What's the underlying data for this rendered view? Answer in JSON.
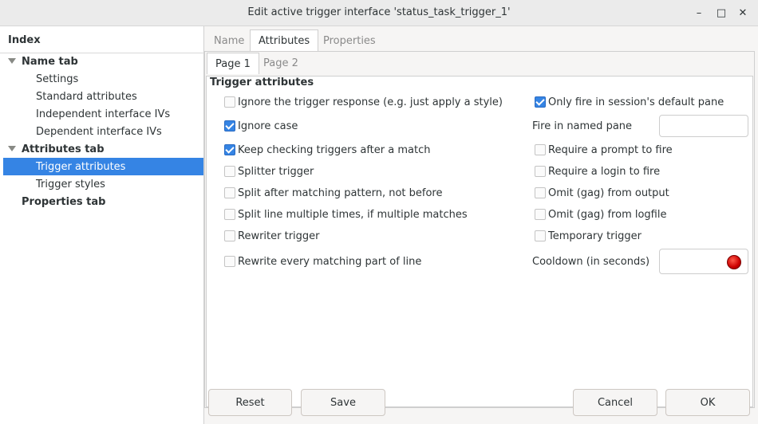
{
  "window": {
    "title": "Edit active trigger interface 'status_task_trigger_1'",
    "minimize_glyph": "–",
    "maximize_glyph": "□",
    "close_glyph": "✕"
  },
  "sidebar": {
    "header": "Index",
    "items": [
      {
        "label": "Name tab",
        "level": 0,
        "expanded": true
      },
      {
        "label": "Settings",
        "level": 1
      },
      {
        "label": "Standard attributes",
        "level": 1
      },
      {
        "label": "Independent interface IVs",
        "level": 1
      },
      {
        "label": "Dependent interface IVs",
        "level": 1
      },
      {
        "label": "Attributes tab",
        "level": 0,
        "expanded": true
      },
      {
        "label": "Trigger attributes",
        "level": 1,
        "selected": true
      },
      {
        "label": "Trigger styles",
        "level": 1
      },
      {
        "label": "Properties tab",
        "level": 0
      }
    ]
  },
  "tabs": [
    {
      "label": "Name",
      "active": false
    },
    {
      "label": "Attributes",
      "active": true
    },
    {
      "label": "Properties",
      "active": false
    }
  ],
  "subtabs": [
    {
      "label": "Page 1",
      "active": true
    },
    {
      "label": "Page 2",
      "active": false
    }
  ],
  "section": {
    "title": "Trigger attributes"
  },
  "left_options": [
    {
      "label": "Ignore the trigger response (e.g. just apply a style)",
      "checked": false
    },
    {
      "label": "Ignore case",
      "checked": true
    },
    {
      "label": "Keep checking triggers after a match",
      "checked": true
    },
    {
      "label": "Splitter trigger",
      "checked": false
    },
    {
      "label": "Split after matching pattern, not before",
      "checked": false
    },
    {
      "label": "Split line multiple times, if multiple matches",
      "checked": false
    },
    {
      "label": "Rewriter trigger",
      "checked": false
    },
    {
      "label": "Rewrite every matching part of line",
      "checked": false
    }
  ],
  "right_options": {
    "only_fire_default_pane": {
      "label": "Only fire in session's default pane",
      "checked": true
    },
    "fire_in_named_pane": {
      "label": "Fire in named pane",
      "value": ""
    },
    "require_prompt": {
      "label": "Require a prompt to fire",
      "checked": false
    },
    "require_login": {
      "label": "Require a login to fire",
      "checked": false
    },
    "omit_output": {
      "label": "Omit (gag) from output",
      "checked": false
    },
    "omit_logfile": {
      "label": "Omit (gag) from logfile",
      "checked": false
    },
    "temporary": {
      "label": "Temporary trigger",
      "checked": false
    },
    "cooldown": {
      "label": "Cooldown (in seconds)",
      "value": "",
      "status_color": "#cc0000"
    }
  },
  "buttons": {
    "reset": "Reset",
    "save": "Save",
    "cancel": "Cancel",
    "ok": "OK"
  }
}
